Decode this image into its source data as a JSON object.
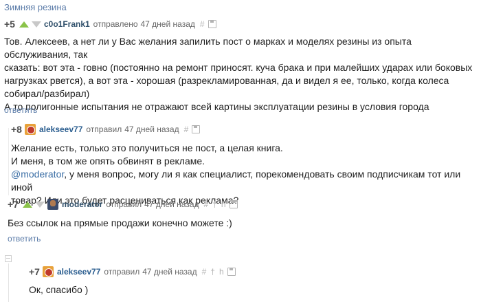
{
  "topic": "Зимняя резина",
  "comments": [
    {
      "rating": "+5",
      "author": "c0o1Frank1",
      "sent": "отправлено",
      "ago": "47 дней назад",
      "hash": "#",
      "body": [
        "Тов. Алексеев, а нет ли у Вас желания запилить пост о марках и моделях резины из опыта обслуживания, так",
        "сказать: вот эта - говно (постоянно на ремонт приносят. куча брака и при малейших ударах или боковых",
        "нагрузках рвется), а вот эта - хорошая (разрекламированная, да и видел я ее, только, когда колеса",
        "собирал/разбирал)",
        "А то полигонные испытания не отражают всей картины эксплуатации резины в условия города"
      ],
      "reply": "ответить"
    },
    {
      "rating": "+8",
      "author": "alekseev77",
      "sent": "отправил",
      "ago": "47 дней назад",
      "hash": "#",
      "body": [
        "Желание есть, только это получиться не пост, а целая книга.",
        "И меня, в том же опять обвинят в рекламе."
      ],
      "mention": "@moderator",
      "body_after": [
        ", у меня вопрос, могу ли я как специалист, порекомендовать своим подписчикам тот или иной",
        "товар? Или это будет расцениваться как реклама?"
      ]
    },
    {
      "rating": "+7",
      "author": "moderator",
      "sent": "отправил",
      "ago": "47 дней назад",
      "hash": "#",
      "tool2": "†",
      "tool3": "h",
      "body": [
        "Без ссылок на прямые продажи конечно можете :)"
      ],
      "reply": "ответить"
    },
    {
      "rating": "+7",
      "author": "alekseev77",
      "sent": "отправил",
      "ago": "47 дней назад",
      "hash": "#",
      "tool2": "†",
      "tool3": "h",
      "body": [
        "Ок, спасибо )"
      ]
    }
  ],
  "colors": {
    "accent": "#5a7ba8",
    "up": "#8bc34a",
    "down": "#c8c8c8"
  }
}
